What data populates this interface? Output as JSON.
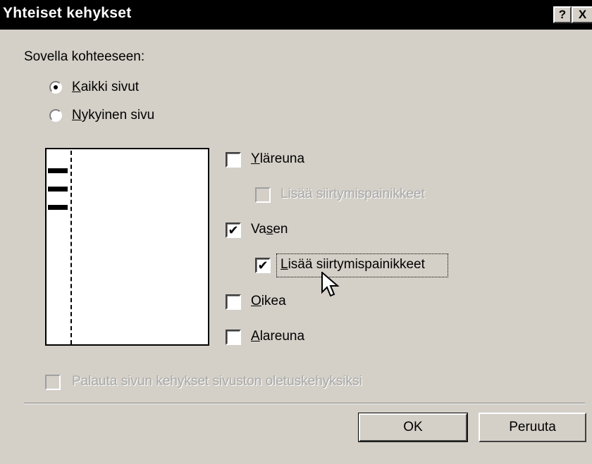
{
  "window": {
    "title": "Yhteiset kehykset",
    "help_glyph": "?",
    "close_glyph": "X"
  },
  "apply_to": {
    "label": "Sovella kohteeseen:",
    "options": [
      {
        "label": "Kaikki sivut",
        "selected": true
      },
      {
        "label": "Nykyinen sivu",
        "selected": false
      }
    ]
  },
  "frames": {
    "top": {
      "label": "Yläreuna",
      "checked": false
    },
    "top_nav": {
      "label": "Lisää siirtymispainikkeet",
      "checked": false,
      "enabled": false
    },
    "left": {
      "label": "Vasen",
      "checked": true
    },
    "left_nav": {
      "label": "Lisää siirtymispainikkeet",
      "checked": true,
      "enabled": true
    },
    "right": {
      "label": "Oikea",
      "checked": false
    },
    "bottom": {
      "label": "Alareuna",
      "checked": false
    }
  },
  "reset": {
    "label": "Palauta sivun kehykset sivuston oletuskehyksiksi",
    "checked": false,
    "enabled": false
  },
  "buttons": {
    "ok": "OK",
    "cancel": "Peruuta"
  },
  "icons": {
    "checkmark": "✔",
    "cursor": "arrow-cursor-icon"
  },
  "colors": {
    "dialog_bg": "#d4d0c8",
    "title_bg": "#000000",
    "disabled_text": "#a8a8a8"
  }
}
